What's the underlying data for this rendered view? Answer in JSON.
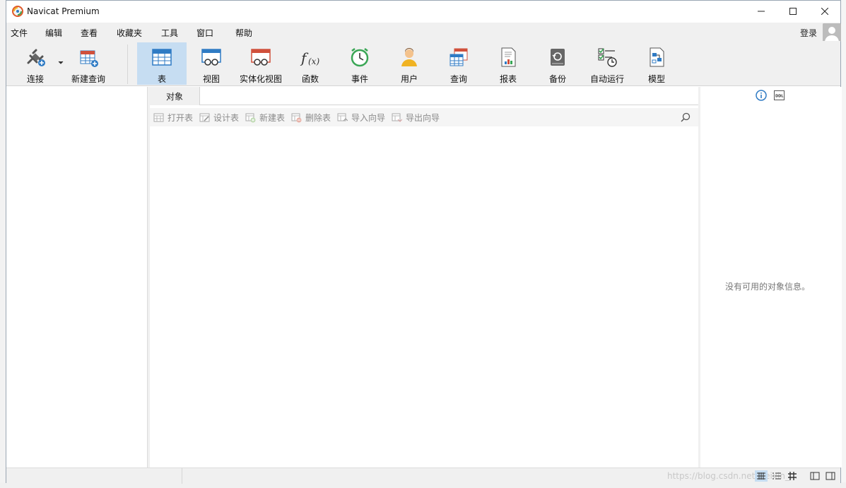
{
  "window": {
    "title": "Navicat Premium",
    "min_symbol": "—",
    "max_symbol": "☐",
    "close_symbol": "✕"
  },
  "menu": {
    "items": [
      "文件",
      "编辑",
      "查看",
      "收藏夹",
      "工具",
      "窗口",
      "帮助"
    ],
    "login": "登录"
  },
  "toolbar": {
    "connect": "连接",
    "new_query": "新建查询",
    "items": [
      {
        "label": "表",
        "icon": "table-icon",
        "active": true
      },
      {
        "label": "视图",
        "icon": "view-icon"
      },
      {
        "label": "实体化视图",
        "icon": "materialized-view-icon"
      },
      {
        "label": "函数",
        "icon": "function-icon"
      },
      {
        "label": "事件",
        "icon": "event-alarm-icon"
      },
      {
        "label": "用户",
        "icon": "user-icon"
      },
      {
        "label": "查询",
        "icon": "query-icon"
      },
      {
        "label": "报表",
        "icon": "report-icon"
      },
      {
        "label": "备份",
        "icon": "backup-icon"
      },
      {
        "label": "自动运行",
        "icon": "automation-icon"
      },
      {
        "label": "模型",
        "icon": "model-icon"
      }
    ]
  },
  "objects_tab": {
    "label": "对象"
  },
  "object_toolbar": {
    "open_table": "打开表",
    "design_table": "设计表",
    "new_table": "新建表",
    "delete_table": "删除表",
    "import_wizard": "导入向导",
    "export_wizard": "导出向导"
  },
  "info_pane": {
    "empty_message": "没有可用的对象信息。",
    "ddl_label": "DDL"
  },
  "status": {
    "watermark": "https://blog.csdn.net/weixin_..."
  },
  "colors": {
    "accent": "#c6ddf2",
    "icon_blue": "#2f7bc4",
    "icon_red": "#d0503b"
  }
}
